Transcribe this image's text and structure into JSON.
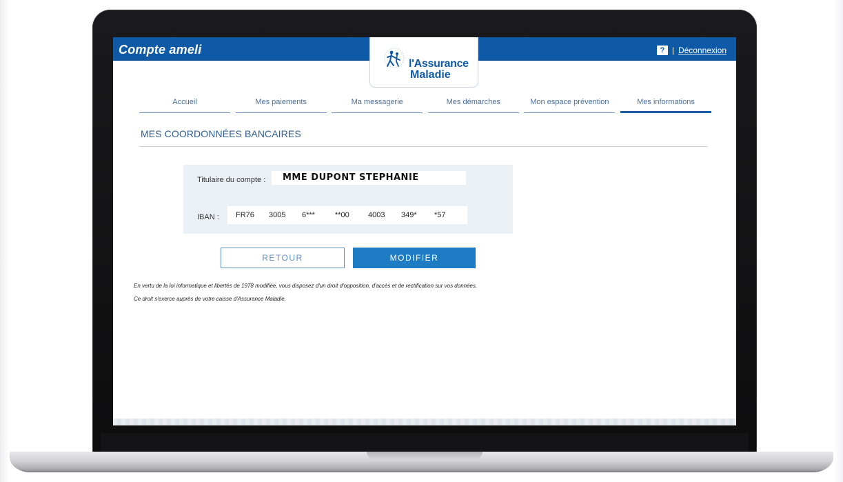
{
  "header": {
    "brand": "Compte ameli",
    "logo_line1": "l'Assurance",
    "logo_line2": "Maladie",
    "help_icon": "?",
    "separator": "|",
    "logout_label": "Déconnexion"
  },
  "nav": {
    "items": [
      {
        "label": "Accueil"
      },
      {
        "label": "Mes paiements"
      },
      {
        "label": "Ma messagerie"
      },
      {
        "label": "Mes démarches"
      },
      {
        "label": "Mon espace prévention"
      },
      {
        "label": "Mes informations"
      }
    ]
  },
  "page": {
    "title": "MES COORDONNÉES BANCAIRES"
  },
  "bank": {
    "holder_label": "Titulaire du compte :",
    "holder_value": "MME DUPONT STEPHANIE",
    "iban_label": "IBAN :",
    "iban_segments": [
      "FR76",
      "3005",
      "6***",
      "**00",
      "4003",
      "349*",
      "*57"
    ]
  },
  "actions": {
    "back_label": "RETOUR",
    "edit_label": "MODIFIER"
  },
  "legal": {
    "line1": "En vertu de la loi informatique et libertés de 1978 modifiée, vous disposez d'un droit d'opposition, d'accès et de rectification sur vos données.",
    "line2": "Ce droit s'exerce auprès de votre caisse d'Assurance Maladie."
  },
  "colors": {
    "brand_blue": "#0f5aa6",
    "button_blue": "#1e7cc4",
    "card_bg": "#ebf0f4"
  }
}
